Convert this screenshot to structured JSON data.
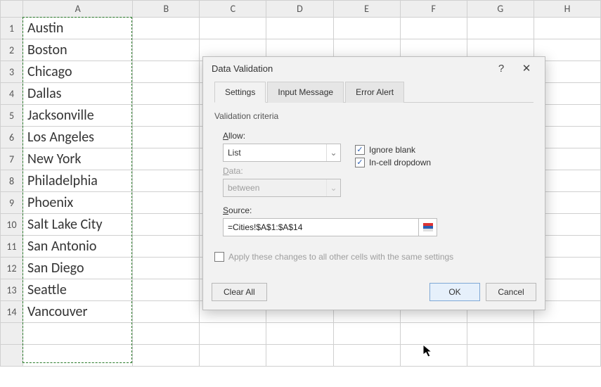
{
  "columns": [
    "A",
    "B",
    "C",
    "D",
    "E",
    "F",
    "G",
    "H"
  ],
  "rows": [
    {
      "num": "1",
      "a": "Austin"
    },
    {
      "num": "2",
      "a": "Boston"
    },
    {
      "num": "3",
      "a": "Chicago"
    },
    {
      "num": "4",
      "a": "Dallas"
    },
    {
      "num": "5",
      "a": "Jacksonville"
    },
    {
      "num": "6",
      "a": "Los Angeles"
    },
    {
      "num": "7",
      "a": "New York"
    },
    {
      "num": "8",
      "a": "Philadelphia"
    },
    {
      "num": "9",
      "a": "Phoenix"
    },
    {
      "num": "10",
      "a": "Salt Lake City"
    },
    {
      "num": "11",
      "a": "San Antonio"
    },
    {
      "num": "12",
      "a": "San Diego"
    },
    {
      "num": "13",
      "a": "Seattle"
    },
    {
      "num": "14",
      "a": "Vancouver"
    }
  ],
  "dialog": {
    "title": "Data Validation",
    "help_tooltip": "?",
    "tabs": {
      "settings": "Settings",
      "input": "Input Message",
      "error": "Error Alert"
    },
    "criteria_label": "Validation criteria",
    "allow_label": "Allow:",
    "allow_value": "List",
    "data_label": "Data:",
    "data_value": "between",
    "ignore_blank": "Ignore blank",
    "incell": "In-cell dropdown",
    "source_label": "Source:",
    "source_value": "=Cities!$A$1:$A$14",
    "apply_label": "Apply these changes to all other cells with the same settings",
    "clear_all": "Clear All",
    "ok": "OK",
    "cancel": "Cancel"
  }
}
